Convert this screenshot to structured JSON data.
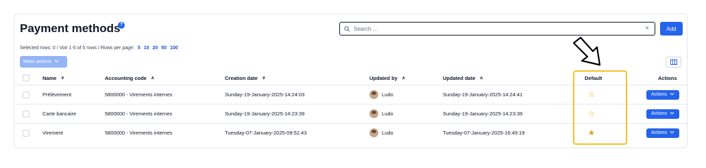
{
  "header": {
    "title": "Payment methods",
    "help_badge": "?",
    "search_placeholder": "Search ...",
    "search_clear": "×",
    "add_label": "Add"
  },
  "meta": {
    "selection_text": "Selected rows: 0 /  Voir 1-5 of 5 rows /  Rows per page:",
    "per_page_options": [
      "5",
      "10",
      "20",
      "50",
      "100"
    ]
  },
  "toolbar": {
    "mass_actions_label": "Mass actions"
  },
  "table": {
    "columns": {
      "name": "Name",
      "accounting_code": "Accounting code",
      "creation_date": "Creation date",
      "updated_by": "Updated by",
      "updated_date": "Updated date",
      "default": "Default",
      "actions": "Actions"
    },
    "rows": [
      {
        "name": "Prélèvement",
        "accounting_code": "5800000 - Virements internes",
        "creation_date": "Sunday-19-January-2025-14:24:03",
        "updated_by": "Ludo",
        "updated_date": "Sunday-19-January-2025-14:24:41",
        "default": false,
        "actions_label": "Actions"
      },
      {
        "name": "Carte bancaire",
        "accounting_code": "5800000 - Virements internes",
        "creation_date": "Sunday-19-January-2025-14:23:39",
        "updated_by": "Ludo",
        "updated_date": "Sunday-19-January-2025-14:23:39",
        "default": false,
        "actions_label": "Actions"
      },
      {
        "name": "Virement",
        "accounting_code": "5800000 - Virements internes",
        "creation_date": "Tuesday-07-January-2025-09:52:43",
        "updated_by": "Ludo",
        "updated_date": "Tuesday-07-January-2025-16:49:19",
        "default": true,
        "actions_label": "Actions"
      }
    ]
  },
  "colors": {
    "accent": "#2563eb",
    "highlight": "#fbbf24",
    "star": "#e69500"
  }
}
